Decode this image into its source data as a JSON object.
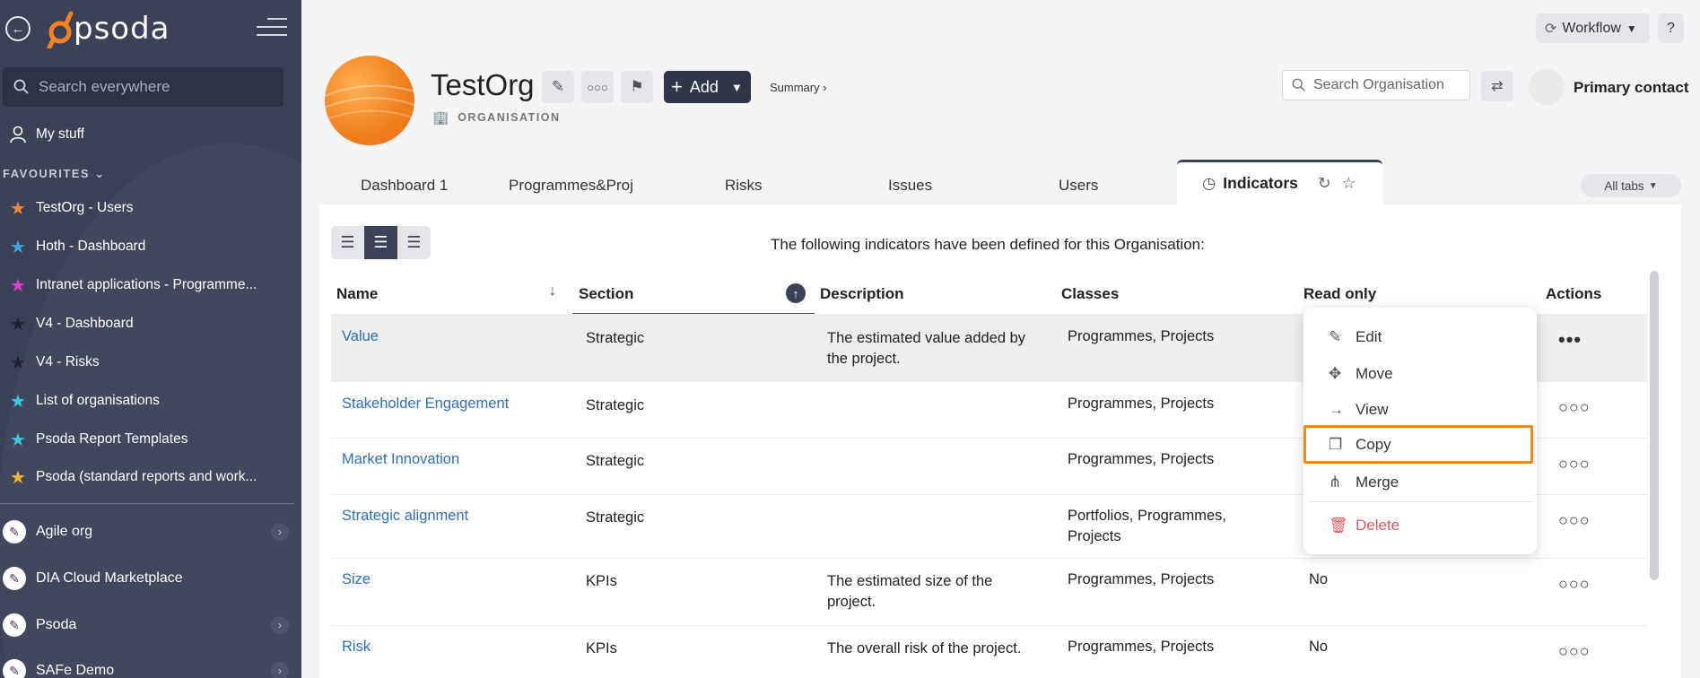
{
  "sidebar": {
    "logo_text": "psoda",
    "search_placeholder": "Search everywhere",
    "my_stuff": "My stuff",
    "favourites_heading": "FAVOURITES",
    "favourites": [
      {
        "label": "TestOrg - Users",
        "color": "#f0853a"
      },
      {
        "label": "Hoth - Dashboard",
        "color": "#3da2e8"
      },
      {
        "label": "Intranet applications - Programme...",
        "color": "#e23fd0"
      },
      {
        "label": "V4 - Dashboard",
        "color": "#1e2230"
      },
      {
        "label": "V4 - Risks",
        "color": "#1e2230"
      },
      {
        "label": "List of organisations",
        "color": "#3ec6e0"
      },
      {
        "label": "Psoda Report Templates",
        "color": "#3ec6e0"
      },
      {
        "label": "Psoda (standard reports and work...",
        "color": "#f3b82d"
      }
    ],
    "organisations": [
      {
        "label": "Agile org",
        "has_arrow": true
      },
      {
        "label": "DIA Cloud Marketplace",
        "has_arrow": false
      },
      {
        "label": "Psoda",
        "has_arrow": true
      },
      {
        "label": "SAFe Demo",
        "has_arrow": true
      }
    ]
  },
  "header": {
    "workflow": "Workflow",
    "help": "?",
    "org_name": "TestOrg",
    "org_type": "ORGANISATION",
    "add_label": "Add",
    "summary_link": "Summary ›",
    "search_placeholder": "Search Organisation",
    "primary_contact": "Primary contact"
  },
  "tabs": [
    "Dashboard 1",
    "Programmes&Proj",
    "Risks",
    "Issues",
    "Users"
  ],
  "active_tab": "Indicators",
  "all_tabs": "All tabs",
  "intro": "The following indicators have been defined for this Organisation:",
  "table": {
    "headers": [
      "Name",
      "Section",
      "Description",
      "Classes",
      "Read only",
      "Actions"
    ],
    "rows": [
      {
        "name": "Value",
        "section": "Strategic",
        "desc1": "The estimated value added by",
        "desc2": "the project.",
        "class1": "Programmes, Projects",
        "class2": "",
        "read_only": ""
      },
      {
        "name": "Stakeholder Engagement",
        "section": "Strategic",
        "desc1": "",
        "desc2": "",
        "class1": "Programmes, Projects",
        "class2": "",
        "read_only": ""
      },
      {
        "name": "Market Innovation",
        "section": "Strategic",
        "desc1": "",
        "desc2": "",
        "class1": "Programmes, Projects",
        "class2": "",
        "read_only": ""
      },
      {
        "name": "Strategic alignment",
        "section": "Strategic",
        "desc1": "",
        "desc2": "",
        "class1": "Portfolios, Programmes,",
        "class2": "Projects",
        "read_only": ""
      },
      {
        "name": "Size",
        "section": "KPIs",
        "desc1": "The estimated size of the",
        "desc2": "project.",
        "class1": "Programmes, Projects",
        "class2": "",
        "read_only": "No"
      },
      {
        "name": "Risk",
        "section": "KPIs",
        "desc1": "The overall risk of the project.",
        "desc2": "",
        "class1": "Programmes, Projects",
        "class2": "",
        "read_only": "No"
      }
    ]
  },
  "context_menu": {
    "edit": "Edit",
    "move": "Move",
    "view": "View",
    "copy": "Copy",
    "merge": "Merge",
    "delete": "Delete"
  }
}
